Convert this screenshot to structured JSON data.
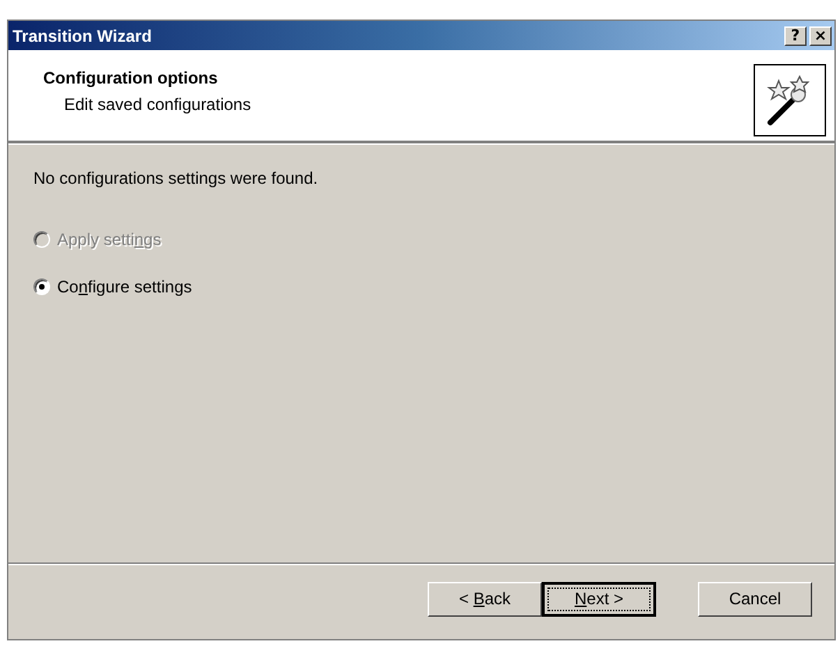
{
  "window": {
    "title": "Transition Wizard",
    "title_buttons": [
      "?",
      "×"
    ]
  },
  "header": {
    "title": "Configuration options",
    "subtitle": "Edit saved configurations"
  },
  "message": "No configurations settings were found.",
  "options": [
    {
      "label": [
        {
          "text": "Apply setti",
          "underlined": false
        },
        {
          "text": "n",
          "underlined": true
        },
        {
          "text": "gs",
          "underlined": false
        }
      ],
      "selected": false,
      "disabled": true
    },
    {
      "label": [
        {
          "text": "Co",
          "underlined": false
        },
        {
          "text": "n",
          "underlined": true
        },
        {
          "text": "figure settings",
          "underlined": false
        }
      ],
      "selected": true,
      "disabled": false
    }
  ],
  "buttons": [
    {
      "label": [
        {
          "text": "< ",
          "underlined": false
        },
        {
          "text": "B",
          "underlined": true
        },
        {
          "text": "ack",
          "underlined": false
        }
      ],
      "default": false
    },
    {
      "label": [
        {
          "text": "N",
          "underlined": true
        },
        {
          "text": "ext >",
          "underlined": false
        }
      ],
      "default": true
    },
    {
      "label": [
        {
          "text": "Cancel",
          "underlined": false
        }
      ],
      "default": false
    }
  ]
}
